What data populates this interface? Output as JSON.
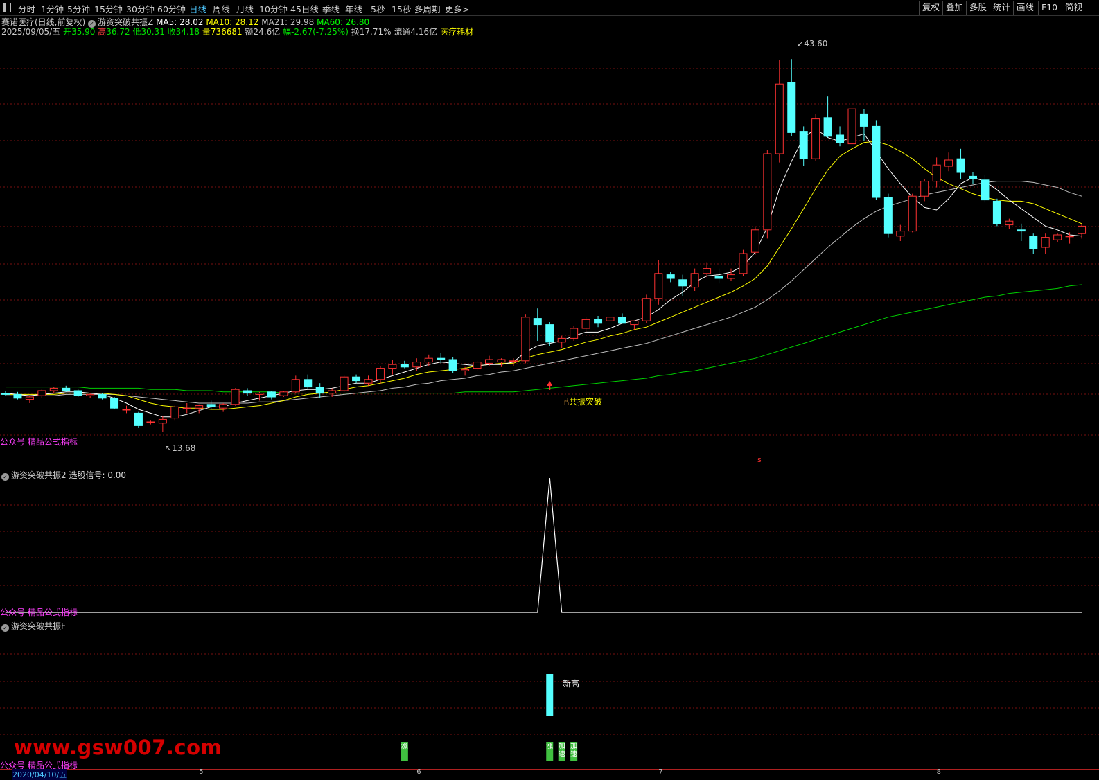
{
  "toolbar": {
    "periods": [
      "分时",
      "1分钟",
      "5分钟",
      "15分钟",
      "30分钟",
      "60分钟",
      "日线",
      "周线",
      "月线",
      "10分钟",
      "45日线",
      "季线",
      "年线",
      "5秒",
      "15秒",
      "多周期",
      "更多>"
    ],
    "active_period": "日线",
    "right_buttons": [
      "复权",
      "叠加",
      "多股",
      "统计",
      "画线",
      "F10",
      "简视"
    ]
  },
  "header": {
    "stock_name": "赛诺医疗(日线,前复权)",
    "indicator_name": "游资突破共振Z",
    "ma5_label": "MA5: 28.02",
    "ma10_label": "MA10: 28.12",
    "ma21_label": "MA21: 29.98",
    "ma60_label": "MA60: 26.80",
    "date": "2025/09/05/五",
    "open_label": "开",
    "open": "35.90",
    "high_label": "高",
    "high": "36.72",
    "low_label": "低",
    "low": "30.31",
    "close_label": "收",
    "close": "34.18",
    "volume_label": "量",
    "volume": "736681",
    "amount": "额24.6亿",
    "change": "幅-2.67(-7.25%)",
    "turnover": "换17.71%",
    "float": "流通4.16亿",
    "sector": "医疗耗材"
  },
  "colors": {
    "up": "#ff3232",
    "down": "#54ffff",
    "ma5": "#ffffff",
    "ma10": "#ffff00",
    "ma21": "#c0c0c0",
    "ma60": "#00d000",
    "grid": "#7a1010",
    "magenta": "#ff40ff"
  },
  "chart_data": [
    {
      "type": "candlestick",
      "title": "",
      "ylim": [
        12.5,
        45
      ],
      "max_label": "43.60",
      "min_label": "13.68",
      "signal_label": "共振突破",
      "footer_label": "公众号 精品公式指标",
      "candles": [
        [
          16.8,
          17.0,
          16.6,
          16.7
        ],
        [
          16.7,
          16.9,
          16.3,
          16.4
        ],
        [
          16.3,
          16.6,
          16.0,
          16.5
        ],
        [
          16.6,
          17.1,
          16.4,
          17.0
        ],
        [
          17.0,
          17.3,
          16.8,
          17.2
        ],
        [
          17.2,
          17.4,
          16.9,
          17.0
        ],
        [
          17.0,
          17.1,
          16.5,
          16.6
        ],
        [
          16.6,
          16.8,
          16.4,
          16.7
        ],
        [
          16.7,
          16.8,
          16.3,
          16.4
        ],
        [
          16.4,
          16.5,
          15.5,
          15.6
        ],
        [
          15.5,
          15.8,
          15.2,
          15.5
        ],
        [
          15.2,
          15.3,
          14.0,
          14.2
        ],
        [
          14.5,
          14.6,
          14.3,
          14.5
        ],
        [
          14.4,
          15.0,
          13.68,
          14.7
        ],
        [
          14.8,
          15.8,
          14.6,
          15.7
        ],
        [
          15.6,
          16.0,
          15.2,
          15.6
        ],
        [
          15.6,
          15.9,
          15.2,
          15.8
        ],
        [
          15.9,
          16.2,
          15.5,
          15.7
        ],
        [
          15.6,
          16.0,
          15.3,
          15.9
        ],
        [
          15.9,
          17.2,
          15.8,
          17.1
        ],
        [
          17.0,
          17.2,
          16.6,
          16.8
        ],
        [
          16.7,
          16.9,
          16.2,
          16.8
        ],
        [
          16.9,
          17.0,
          16.3,
          16.5
        ],
        [
          16.6,
          17.0,
          16.5,
          16.9
        ],
        [
          16.9,
          18.2,
          16.8,
          17.9
        ],
        [
          17.9,
          18.3,
          17.1,
          17.3
        ],
        [
          17.3,
          17.6,
          16.4,
          16.8
        ],
        [
          16.8,
          17.2,
          16.5,
          17.0
        ],
        [
          17.0,
          18.2,
          16.9,
          18.1
        ],
        [
          18.1,
          18.3,
          17.6,
          17.8
        ],
        [
          17.6,
          18.2,
          17.4,
          17.9
        ],
        [
          17.9,
          19.0,
          17.5,
          18.8
        ],
        [
          18.8,
          19.5,
          18.3,
          19.1
        ],
        [
          19.1,
          19.4,
          18.8,
          18.9
        ],
        [
          18.9,
          19.6,
          18.6,
          19.3
        ],
        [
          19.3,
          19.9,
          19.0,
          19.6
        ],
        [
          19.6,
          20.0,
          19.2,
          19.5
        ],
        [
          19.5,
          19.7,
          18.4,
          18.6
        ],
        [
          18.6,
          18.9,
          18.2,
          18.7
        ],
        [
          18.8,
          19.4,
          18.6,
          19.3
        ],
        [
          19.2,
          19.8,
          19.0,
          19.5
        ],
        [
          19.3,
          19.6,
          18.9,
          19.5
        ],
        [
          19.4,
          19.6,
          19.0,
          19.4
        ],
        [
          19.4,
          23.1,
          19.2,
          22.9
        ],
        [
          22.8,
          23.6,
          21.0,
          22.3
        ],
        [
          22.3,
          22.5,
          20.6,
          20.9
        ],
        [
          20.9,
          21.4,
          20.4,
          21.2
        ],
        [
          21.2,
          22.2,
          21.0,
          22.0
        ],
        [
          22.0,
          22.9,
          21.7,
          22.7
        ],
        [
          22.7,
          23.0,
          22.1,
          22.4
        ],
        [
          22.6,
          23.1,
          22.2,
          22.9
        ],
        [
          22.9,
          23.2,
          22.4,
          22.4
        ],
        [
          22.3,
          22.6,
          21.9,
          22.6
        ],
        [
          22.6,
          24.7,
          22.4,
          24.4
        ],
        [
          24.4,
          27.5,
          23.9,
          26.4
        ],
        [
          26.3,
          26.5,
          25.7,
          26.0
        ],
        [
          25.9,
          26.3,
          24.6,
          25.4
        ],
        [
          25.3,
          26.8,
          25.0,
          26.4
        ],
        [
          26.4,
          27.3,
          26.1,
          26.8
        ],
        [
          26.2,
          26.8,
          25.6,
          26.0
        ],
        [
          26.0,
          26.8,
          25.8,
          26.3
        ],
        [
          26.4,
          28.3,
          26.2,
          28.0
        ],
        [
          28.1,
          30.1,
          27.9,
          29.9
        ],
        [
          29.9,
          36.3,
          29.2,
          36.0
        ],
        [
          36.0,
          43.5,
          35.3,
          41.6
        ],
        [
          41.7,
          43.6,
          37.4,
          37.7
        ],
        [
          37.8,
          38.2,
          35.0,
          35.6
        ],
        [
          35.6,
          39.2,
          35.4,
          38.8
        ],
        [
          38.9,
          40.6,
          37.3,
          37.4
        ],
        [
          37.5,
          38.2,
          36.6,
          36.9
        ],
        [
          36.8,
          39.8,
          35.7,
          39.6
        ],
        [
          39.2,
          39.6,
          37.0,
          38.2
        ],
        [
          38.2,
          38.7,
          32.3,
          32.5
        ],
        [
          32.5,
          32.8,
          29.3,
          29.6
        ],
        [
          29.4,
          30.3,
          29.0,
          29.8
        ],
        [
          29.8,
          32.8,
          29.7,
          32.6
        ],
        [
          32.6,
          34.0,
          32.2,
          33.8
        ],
        [
          33.8,
          35.7,
          33.3,
          35.1
        ],
        [
          35.0,
          36.1,
          34.6,
          35.5
        ],
        [
          35.6,
          36.4,
          34.0,
          34.5
        ],
        [
          34.2,
          34.5,
          33.6,
          34.0
        ],
        [
          33.9,
          34.3,
          32.1,
          32.3
        ],
        [
          32.2,
          32.4,
          30.2,
          30.4
        ],
        [
          30.3,
          30.8,
          30.0,
          30.6
        ],
        [
          29.9,
          30.4,
          29.0,
          29.8
        ],
        [
          29.4,
          29.6,
          28.0,
          28.4
        ],
        [
          28.5,
          29.6,
          28.0,
          29.3
        ],
        [
          29.1,
          29.6,
          28.9,
          29.5
        ],
        [
          29.4,
          29.7,
          28.8,
          29.4
        ],
        [
          29.6,
          30.4,
          29.2,
          30.2
        ]
      ],
      "ma5": [
        16.8,
        16.7,
        16.6,
        16.7,
        16.8,
        16.9,
        16.9,
        16.8,
        16.7,
        16.4,
        16.0,
        15.5,
        15.2,
        14.9,
        14.9,
        15.1,
        15.4,
        15.7,
        15.7,
        16.0,
        16.2,
        16.4,
        16.6,
        16.8,
        17.0,
        17.1,
        17.1,
        17.2,
        17.4,
        17.6,
        17.6,
        17.9,
        18.2,
        18.5,
        18.8,
        19.1,
        19.3,
        19.2,
        19.1,
        19.0,
        19.1,
        19.1,
        19.3,
        20.1,
        20.6,
        20.8,
        21.0,
        21.4,
        21.7,
        21.7,
        22.0,
        22.4,
        22.6,
        22.9,
        23.5,
        24.3,
        24.9,
        25.7,
        26.2,
        26.3,
        26.5,
        27.0,
        28.1,
        30.1,
        33.2,
        35.4,
        37.3,
        38.0,
        37.3,
        37.0,
        37.3,
        37.6,
        36.2,
        34.8,
        33.6,
        32.5,
        31.7,
        31.5,
        32.4,
        33.6,
        34.1,
        33.8,
        33.1,
        32.3,
        31.6,
        30.9,
        30.2,
        29.9,
        29.5,
        29.4
      ],
      "ma10": [
        16.7,
        16.7,
        16.7,
        16.7,
        16.7,
        16.8,
        16.8,
        16.8,
        16.8,
        16.7,
        16.6,
        16.3,
        16.0,
        15.8,
        15.7,
        15.6,
        15.6,
        15.5,
        15.5,
        15.6,
        15.7,
        15.8,
        16.0,
        16.2,
        16.5,
        16.7,
        16.8,
        16.9,
        17.1,
        17.3,
        17.4,
        17.6,
        17.8,
        18.0,
        18.3,
        18.5,
        18.6,
        18.7,
        18.8,
        19.0,
        19.1,
        19.2,
        19.2,
        19.6,
        19.9,
        20.1,
        20.3,
        20.6,
        20.9,
        21.1,
        21.4,
        21.6,
        21.9,
        22.1,
        22.5,
        22.9,
        23.3,
        23.7,
        24.1,
        24.5,
        24.9,
        25.4,
        26.0,
        27.0,
        28.5,
        30.0,
        31.6,
        33.2,
        34.7,
        35.8,
        36.4,
        36.9,
        37.0,
        36.7,
        36.2,
        35.6,
        34.8,
        34.1,
        33.6,
        33.2,
        32.8,
        32.5,
        32.3,
        32.2,
        32.2,
        32.0,
        31.6,
        31.2,
        30.8,
        30.4
      ],
      "ma21": [
        16.6,
        16.6,
        16.6,
        16.6,
        16.6,
        16.7,
        16.7,
        16.7,
        16.7,
        16.7,
        16.6,
        16.5,
        16.4,
        16.3,
        16.2,
        16.1,
        16.0,
        16.0,
        16.0,
        16.0,
        16.0,
        16.1,
        16.1,
        16.2,
        16.3,
        16.4,
        16.5,
        16.6,
        16.7,
        16.8,
        16.9,
        17.0,
        17.2,
        17.3,
        17.5,
        17.6,
        17.8,
        17.9,
        18.0,
        18.2,
        18.3,
        18.5,
        18.6,
        18.8,
        19.0,
        19.2,
        19.4,
        19.6,
        19.8,
        20.0,
        20.2,
        20.4,
        20.6,
        20.8,
        21.1,
        21.4,
        21.7,
        22.0,
        22.3,
        22.6,
        22.9,
        23.3,
        23.7,
        24.3,
        25.0,
        25.8,
        26.7,
        27.6,
        28.5,
        29.3,
        30.1,
        30.8,
        31.4,
        31.8,
        32.1,
        32.4,
        32.7,
        32.9,
        33.1,
        33.3,
        33.5,
        33.7,
        33.8,
        33.8,
        33.8,
        33.7,
        33.5,
        33.3,
        32.9,
        32.6
      ],
      "ma60": [
        17.3,
        17.3,
        17.3,
        17.3,
        17.3,
        17.3,
        17.3,
        17.2,
        17.2,
        17.2,
        17.2,
        17.2,
        17.1,
        17.1,
        17.1,
        17.0,
        17.0,
        17.0,
        16.9,
        16.9,
        16.9,
        16.9,
        16.9,
        16.8,
        16.8,
        16.8,
        16.8,
        16.8,
        16.8,
        16.8,
        16.8,
        16.8,
        16.8,
        16.8,
        16.8,
        16.8,
        16.8,
        16.8,
        16.9,
        16.9,
        16.9,
        16.9,
        16.9,
        17.0,
        17.1,
        17.2,
        17.3,
        17.4,
        17.5,
        17.6,
        17.7,
        17.8,
        17.9,
        18.0,
        18.2,
        18.3,
        18.5,
        18.6,
        18.8,
        19.0,
        19.2,
        19.4,
        19.6,
        19.9,
        20.2,
        20.5,
        20.8,
        21.1,
        21.4,
        21.7,
        22.0,
        22.3,
        22.6,
        22.9,
        23.1,
        23.3,
        23.5,
        23.7,
        23.9,
        24.1,
        24.3,
        24.5,
        24.6,
        24.8,
        24.9,
        25.0,
        25.1,
        25.2,
        25.4,
        25.5
      ],
      "signal_index": 45
    },
    {
      "type": "line",
      "title": "游资突破共振2",
      "value_label": "选股信号: 0.00",
      "footer_label": "公众号 精品公式指标",
      "ylim": [
        0,
        1
      ],
      "values": [
        0,
        0,
        0,
        0,
        0,
        0,
        0,
        0,
        0,
        0,
        0,
        0,
        0,
        0,
        0,
        0,
        0,
        0,
        0,
        0,
        0,
        0,
        0,
        0,
        0,
        0,
        0,
        0,
        0,
        0,
        0,
        0,
        0,
        0,
        0,
        0,
        0,
        0,
        0,
        0,
        0,
        0,
        0,
        0,
        0,
        1,
        0,
        0,
        0,
        0,
        0,
        0,
        0,
        0,
        0,
        0,
        0,
        0,
        0,
        0,
        0,
        0,
        0,
        0,
        0,
        0,
        0,
        0,
        0,
        0,
        0,
        0,
        0,
        0,
        0,
        0,
        0,
        0,
        0,
        0,
        0,
        0,
        0,
        0,
        0,
        0,
        0,
        0,
        0,
        0
      ]
    },
    {
      "type": "bar",
      "title": "游资突破共振F",
      "bar_label": "新高",
      "bar_index": 45,
      "small_bars": [
        {
          "index": 33,
          "label": "涨"
        },
        {
          "index": 45,
          "label": "涨"
        },
        {
          "index": 46,
          "label": "加速"
        },
        {
          "index": 47,
          "label": "加速"
        }
      ],
      "footer_label": "公众号 精品公式指标",
      "date_label": "2020/04/10/五",
      "month_ticks": [
        "5",
        "6",
        "7",
        "8"
      ],
      "month_tick_indices": [
        16,
        34,
        54,
        77
      ]
    }
  ],
  "watermark": "www.gsw007.com",
  "cursor_symbol": "s"
}
